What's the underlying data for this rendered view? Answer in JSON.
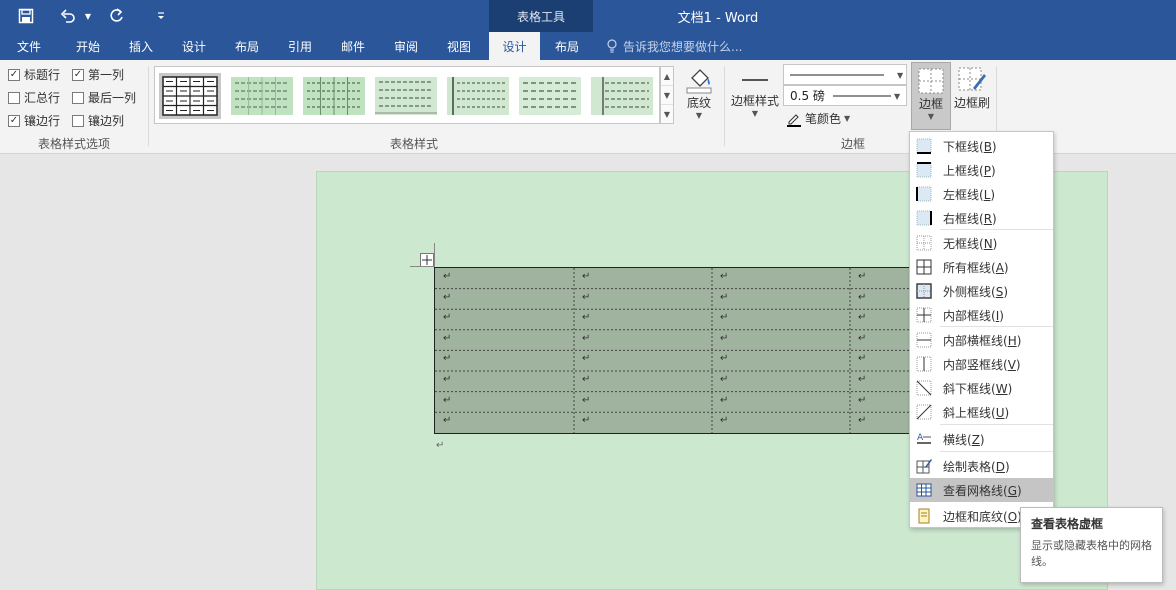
{
  "titlebar": {
    "context_label": "表格工具",
    "window_title": "文档1 - Word",
    "qat": {
      "save_icon": "save-icon",
      "undo_icon": "undo-icon",
      "undo_dropdown_icon": "chevron-down-icon",
      "redo_icon": "redo-icon",
      "customize_icon": "customize-qat-icon"
    }
  },
  "tabs": [
    {
      "label": "文件"
    },
    {
      "label": "开始"
    },
    {
      "label": "插入"
    },
    {
      "label": "设计"
    },
    {
      "label": "布局"
    },
    {
      "label": "引用"
    },
    {
      "label": "邮件"
    },
    {
      "label": "审阅"
    },
    {
      "label": "视图"
    },
    {
      "label": "设计",
      "active": true
    },
    {
      "label": "布局"
    }
  ],
  "tellme": "告诉我您想要做什么...",
  "style_options": {
    "label": "表格样式选项",
    "items": [
      {
        "label": "标题行",
        "checked": true
      },
      {
        "label": "第一列",
        "checked": true
      },
      {
        "label": "汇总行",
        "checked": false
      },
      {
        "label": "最后一列",
        "checked": false
      },
      {
        "label": "镶边行",
        "checked": true
      },
      {
        "label": "镶边列",
        "checked": false
      }
    ]
  },
  "table_styles": {
    "label": "表格样式"
  },
  "shading": {
    "label": "底纹"
  },
  "borders_group": {
    "label": "边框",
    "border_styles_label": "边框样式",
    "weight_value": "0.5 磅",
    "pen_color_label": "笔颜色",
    "borders_button_label": "边框",
    "border_painter_label": "边框刷"
  },
  "border_menu": [
    {
      "label": "下框线(",
      "key": "B",
      "icon": "bottom-border-icon"
    },
    {
      "label": "上框线(",
      "key": "P",
      "icon": "top-border-icon"
    },
    {
      "label": "左框线(",
      "key": "L",
      "icon": "left-border-icon"
    },
    {
      "label": "右框线(",
      "key": "R",
      "icon": "right-border-icon"
    },
    {
      "label": "无框线(",
      "key": "N",
      "icon": "no-border-icon"
    },
    {
      "label": "所有框线(",
      "key": "A",
      "icon": "all-borders-icon"
    },
    {
      "label": "外侧框线(",
      "key": "S",
      "icon": "outside-borders-icon"
    },
    {
      "label": "内部框线(",
      "key": "I",
      "icon": "inside-borders-icon"
    },
    {
      "label": "内部横框线(",
      "key": "H",
      "icon": "inside-horizontal-border-icon"
    },
    {
      "label": "内部竖框线(",
      "key": "V",
      "icon": "inside-vertical-border-icon"
    },
    {
      "label": "斜下框线(",
      "key": "W",
      "icon": "diagonal-down-border-icon"
    },
    {
      "label": "斜上框线(",
      "key": "U",
      "icon": "diagonal-up-border-icon"
    },
    {
      "label": "横线(",
      "key": "Z",
      "icon": "horizontal-line-icon"
    },
    {
      "label": "绘制表格(",
      "key": "D",
      "icon": "draw-table-icon"
    },
    {
      "label": "查看网格线(",
      "key": "G",
      "icon": "view-gridlines-icon",
      "hover": true
    },
    {
      "label": "边框和底纹(",
      "key": "O",
      "icon": "borders-shading-icon"
    }
  ],
  "tooltip": {
    "title": "查看表格虚框",
    "body": "显示或隐藏表格中的网格线。"
  },
  "document": {
    "cell_mark": "↵",
    "rows": 8,
    "cols": 4,
    "colors": {
      "page": "#cce8cf",
      "table": "#9fb39f",
      "accent": "#2b579a"
    }
  }
}
